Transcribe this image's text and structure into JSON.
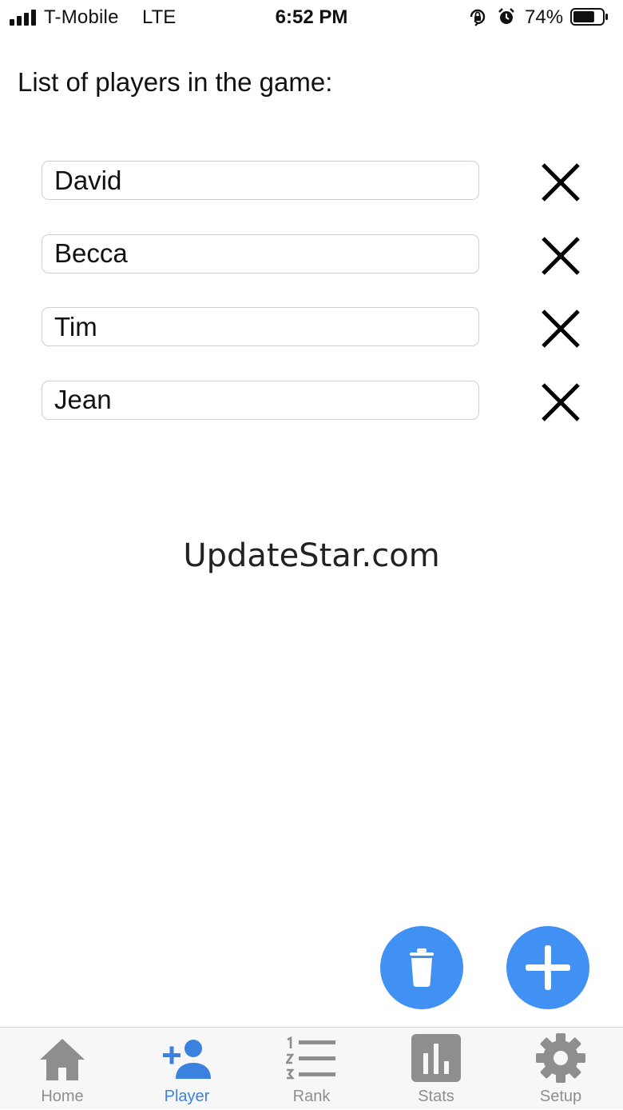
{
  "status_bar": {
    "carrier": "T-Mobile",
    "network": "LTE",
    "time": "6:52 PM",
    "battery_percent": "74%",
    "battery_level": 0.74,
    "icons": [
      "signal-icon",
      "orientation-lock-icon",
      "alarm-icon",
      "battery-icon"
    ]
  },
  "page": {
    "heading": "List of players in the game:"
  },
  "players": [
    {
      "name": "David"
    },
    {
      "name": "Becca"
    },
    {
      "name": "Tim"
    },
    {
      "name": "Jean"
    }
  ],
  "watermark": "UpdateStar.com",
  "actions": {
    "icons": [
      "trash-icon",
      "plus-icon"
    ]
  },
  "tabs": [
    {
      "label": "Home",
      "icon": "home-icon",
      "active": false
    },
    {
      "label": "Player",
      "icon": "add-person-icon",
      "active": true
    },
    {
      "label": "Rank",
      "icon": "ordered-list-icon",
      "active": false
    },
    {
      "label": "Stats",
      "icon": "bar-chart-icon",
      "active": false
    },
    {
      "label": "Setup",
      "icon": "gear-icon",
      "active": false
    }
  ],
  "colors": {
    "accent": "#4191f4",
    "active_tab": "#3b82e0",
    "inactive_tab": "#8e8e8e",
    "tab_bar_bg": "#f7f7f7"
  }
}
